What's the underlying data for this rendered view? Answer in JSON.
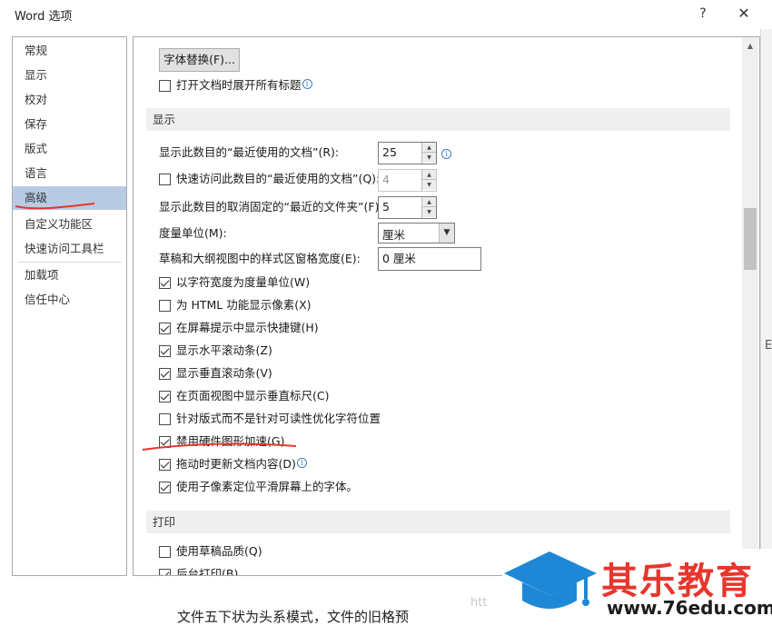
{
  "window": {
    "title": "Word 选项",
    "help_label": "?",
    "close_label": "✕"
  },
  "sidebar": {
    "items": [
      {
        "label": "常规"
      },
      {
        "label": "显示"
      },
      {
        "label": "校对"
      },
      {
        "label": "保存"
      },
      {
        "label": "版式"
      },
      {
        "label": "语言"
      },
      {
        "label": "高级",
        "selected": true
      },
      {
        "label": "自定义功能区"
      },
      {
        "label": "快速访问工具栏"
      },
      {
        "label": "加载项"
      },
      {
        "label": "信任中心"
      }
    ]
  },
  "top": {
    "font_substitution_button": "字体替换(F)...",
    "expand_headings": {
      "label": "打开文档时展开所有标题",
      "checked": false
    }
  },
  "display": {
    "section_title": "显示",
    "recent_docs": {
      "label": "显示此数目的“最近使用的文档”(R):",
      "value": "25"
    },
    "quick_access": {
      "label": "快速访问此数目的“最近使用的文档”(Q):",
      "value": "4",
      "checked": false
    },
    "unpinned_folders": {
      "label": "显示此数目的取消固定的“最近的文件夹”(F):",
      "value": "5"
    },
    "units": {
      "label": "度量单位(M):",
      "value": "厘米"
    },
    "style_area_width": {
      "label": "草稿和大纲视图中的样式区窗格宽度(E):",
      "value": "0 厘米"
    },
    "options": [
      {
        "label": "以字符宽度为度量单位(W)",
        "checked": true
      },
      {
        "label": "为 HTML 功能显示像素(X)",
        "checked": false
      },
      {
        "label": "在屏幕提示中显示快捷键(H)",
        "checked": true
      },
      {
        "label": "显示水平滚动条(Z)",
        "checked": true
      },
      {
        "label": "显示垂直滚动条(V)",
        "checked": true
      },
      {
        "label": "在页面视图中显示垂直标尺(C)",
        "checked": true
      },
      {
        "label": "针对版式而不是针对可读性优化字符位置",
        "checked": false
      },
      {
        "label": "禁用硬件图形加速(G)",
        "checked": true
      },
      {
        "label": "拖动时更新文档内容(D)",
        "checked": true
      },
      {
        "label": "使用子像素定位平滑屏幕上的字体。",
        "checked": true
      }
    ]
  },
  "print": {
    "section_title": "打印",
    "options": [
      {
        "label": "使用草稿品质(Q)",
        "checked": false
      },
      {
        "label": "后台打印(B)",
        "checked": true
      }
    ]
  },
  "branding": {
    "name": "其乐教育",
    "url": "www.76edu.com",
    "watermark": "htt"
  },
  "bottom_text": "文件五下状为头系模式，文件的旧格预",
  "annotation_color": "#e8362d",
  "accent_color": "#b8cbe5"
}
